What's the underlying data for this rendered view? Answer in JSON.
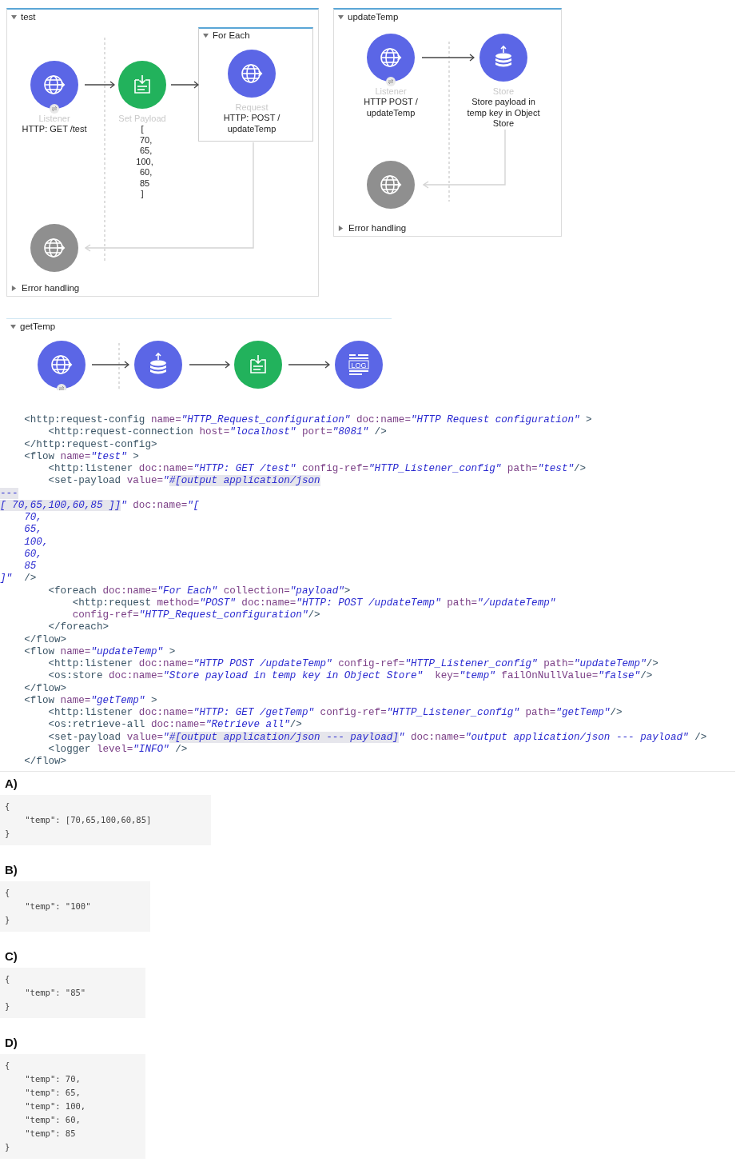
{
  "flows": [
    {
      "title": "test",
      "expanded": true,
      "nodes": [
        {
          "kind": "listener",
          "type_label": "Listener",
          "caption": "HTTP: GET /test"
        },
        {
          "kind": "set-payload",
          "type_label": "Set Payload",
          "caption": "[\n   70,\n   65,\n  100,\n   60,\n  85\n]"
        },
        {
          "kind": "request",
          "type_label": "Request",
          "caption": "HTTP: POST /\nupdateTemp"
        }
      ],
      "scope": {
        "title": "For Each",
        "expanded": true
      },
      "error_handling": {
        "label": "Error handling",
        "expanded": false
      }
    },
    {
      "title": "updateTemp",
      "expanded": true,
      "nodes": [
        {
          "kind": "listener",
          "type_label": "Listener",
          "caption": "HTTP POST /\nupdateTemp"
        },
        {
          "kind": "store",
          "type_label": "Store",
          "caption": "Store payload in\ntemp key in Object\nStore"
        }
      ],
      "error_handling": {
        "label": "Error handling",
        "expanded": false
      }
    },
    {
      "title": "getTemp",
      "expanded": true,
      "nodes": [
        {
          "kind": "listener"
        },
        {
          "kind": "store"
        },
        {
          "kind": "set-payload"
        },
        {
          "kind": "logger",
          "icon_text": "LOG"
        }
      ]
    }
  ],
  "code_lines": [
    [
      {
        "kind": "tag",
        "text": "    <http:request-config "
      },
      {
        "kind": "attr",
        "text": "name="
      },
      {
        "kind": "value",
        "text": "\"HTTP_Request_configuration\""
      },
      {
        "kind": "attr",
        "text": " doc:name="
      },
      {
        "kind": "value",
        "text": "\"HTTP Request configuration\""
      },
      {
        "kind": "tag",
        "text": " >"
      }
    ],
    [
      {
        "kind": "tag",
        "text": "        <http:request-connection "
      },
      {
        "kind": "attr",
        "text": "host="
      },
      {
        "kind": "value",
        "text": "\"localhost\""
      },
      {
        "kind": "attr",
        "text": " port="
      },
      {
        "kind": "value",
        "text": "\"8081\""
      },
      {
        "kind": "tag",
        "text": " />"
      }
    ],
    [
      {
        "kind": "tag",
        "text": "    </http:request-config>"
      }
    ],
    [
      {
        "kind": "tag",
        "text": "    <flow "
      },
      {
        "kind": "attr",
        "text": "name="
      },
      {
        "kind": "value",
        "text": "\"test\""
      },
      {
        "kind": "tag",
        "text": " >"
      }
    ],
    [
      {
        "kind": "tag",
        "text": "        <http:listener "
      },
      {
        "kind": "attr",
        "text": "doc:name="
      },
      {
        "kind": "value",
        "text": "\"HTTP: GET /test\""
      },
      {
        "kind": "attr",
        "text": " config-ref="
      },
      {
        "kind": "value",
        "text": "\"HTTP_Listener_config\""
      },
      {
        "kind": "attr",
        "text": " path="
      },
      {
        "kind": "value",
        "text": "\"test\""
      },
      {
        "kind": "tag",
        "text": "/>"
      }
    ],
    [
      {
        "kind": "tag",
        "text": "        <set-payload "
      },
      {
        "kind": "attr",
        "text": "value="
      },
      {
        "kind": "value",
        "text": "\""
      },
      {
        "kind": "value",
        "text": "#[output application/json",
        "highlighted": true
      }
    ],
    [
      {
        "kind": "value",
        "text": "---",
        "highlighted": true
      }
    ],
    [
      {
        "kind": "value",
        "text": "[ 70,65,100,60,85 ]]",
        "highlighted": true
      },
      {
        "kind": "value",
        "text": "\""
      },
      {
        "kind": "attr",
        "text": " doc:name="
      },
      {
        "kind": "value",
        "text": "\"["
      }
    ],
    [
      {
        "kind": "value",
        "text": "    70,"
      }
    ],
    [
      {
        "kind": "value",
        "text": "    65,"
      }
    ],
    [
      {
        "kind": "value",
        "text": "    100,"
      }
    ],
    [
      {
        "kind": "value",
        "text": "    60,"
      }
    ],
    [
      {
        "kind": "value",
        "text": "    85"
      }
    ],
    [
      {
        "kind": "value",
        "text": "]\""
      },
      {
        "kind": "tag",
        "text": "  />"
      }
    ],
    [
      {
        "kind": "tag",
        "text": "        <foreach "
      },
      {
        "kind": "attr",
        "text": "doc:name="
      },
      {
        "kind": "value",
        "text": "\"For Each\""
      },
      {
        "kind": "attr",
        "text": " collection="
      },
      {
        "kind": "value",
        "text": "\"payload\""
      },
      {
        "kind": "tag",
        "text": ">"
      }
    ],
    [
      {
        "kind": "tag",
        "text": "            <http:request "
      },
      {
        "kind": "attr",
        "text": "method="
      },
      {
        "kind": "value",
        "text": "\"POST\""
      },
      {
        "kind": "attr",
        "text": " doc:name="
      },
      {
        "kind": "value",
        "text": "\"HTTP: POST /updateTemp\""
      },
      {
        "kind": "attr",
        "text": " path="
      },
      {
        "kind": "value",
        "text": "\"/updateTemp\""
      }
    ],
    [
      {
        "kind": "attr",
        "text": "            config-ref="
      },
      {
        "kind": "value",
        "text": "\"HTTP_Request_configuration\""
      },
      {
        "kind": "tag",
        "text": "/>"
      }
    ],
    [
      {
        "kind": "tag",
        "text": "        </foreach>"
      }
    ],
    [
      {
        "kind": "tag",
        "text": "    </flow>"
      }
    ],
    [
      {
        "kind": "tag",
        "text": "    <flow "
      },
      {
        "kind": "attr",
        "text": "name="
      },
      {
        "kind": "value",
        "text": "\"updateTemp\""
      },
      {
        "kind": "tag",
        "text": " >"
      }
    ],
    [
      {
        "kind": "tag",
        "text": "        <http:listener "
      },
      {
        "kind": "attr",
        "text": "doc:name="
      },
      {
        "kind": "value",
        "text": "\"HTTP POST /updateTemp\""
      },
      {
        "kind": "attr",
        "text": " config-ref="
      },
      {
        "kind": "value",
        "text": "\"HTTP_Listener_config\""
      },
      {
        "kind": "attr",
        "text": " path="
      },
      {
        "kind": "value",
        "text": "\"updateTemp\""
      },
      {
        "kind": "tag",
        "text": "/>"
      }
    ],
    [
      {
        "kind": "tag",
        "text": "        <os:store "
      },
      {
        "kind": "attr",
        "text": "doc:name="
      },
      {
        "kind": "value",
        "text": "\"Store payload in temp key in Object Store\""
      },
      {
        "kind": "attr",
        "text": "  key="
      },
      {
        "kind": "value",
        "text": "\"temp\""
      },
      {
        "kind": "attr",
        "text": " failOnNullValue="
      },
      {
        "kind": "value",
        "text": "\"false\""
      },
      {
        "kind": "tag",
        "text": "/>"
      }
    ],
    [
      {
        "kind": "tag",
        "text": "    </flow>"
      }
    ],
    [
      {
        "kind": "tag",
        "text": "    <flow "
      },
      {
        "kind": "attr",
        "text": "name="
      },
      {
        "kind": "value",
        "text": "\"getTemp\""
      },
      {
        "kind": "tag",
        "text": " >"
      }
    ],
    [
      {
        "kind": "tag",
        "text": "        <http:listener "
      },
      {
        "kind": "attr",
        "text": "doc:name="
      },
      {
        "kind": "value",
        "text": "\"HTTP: GET /getTemp\""
      },
      {
        "kind": "attr",
        "text": " config-ref="
      },
      {
        "kind": "value",
        "text": "\"HTTP_Listener_config\""
      },
      {
        "kind": "attr",
        "text": " path="
      },
      {
        "kind": "value",
        "text": "\"getTemp\""
      },
      {
        "kind": "tag",
        "text": "/>"
      }
    ],
    [
      {
        "kind": "tag",
        "text": "        <os:retrieve-all "
      },
      {
        "kind": "attr",
        "text": "doc:name="
      },
      {
        "kind": "value",
        "text": "\"Retrieve all\""
      },
      {
        "kind": "tag",
        "text": "/>"
      }
    ],
    [
      {
        "kind": "tag",
        "text": "        <set-payload "
      },
      {
        "kind": "attr",
        "text": "value="
      },
      {
        "kind": "value",
        "text": "\""
      },
      {
        "kind": "value",
        "text": "#[output application/json --- payload]",
        "highlighted": true
      },
      {
        "kind": "value",
        "text": "\""
      },
      {
        "kind": "attr",
        "text": " doc:name="
      },
      {
        "kind": "value",
        "text": "\"output application/json --- payload\""
      },
      {
        "kind": "tag",
        "text": " />"
      }
    ],
    [
      {
        "kind": "tag",
        "text": "        <logger "
      },
      {
        "kind": "attr",
        "text": "level="
      },
      {
        "kind": "value",
        "text": "\"INFO\""
      },
      {
        "kind": "tag",
        "text": " />"
      }
    ],
    [
      {
        "kind": "tag",
        "text": "    </flow>"
      }
    ]
  ],
  "options": [
    {
      "label": "A)",
      "lines": [
        "{",
        "    \"temp\": [70,65,100,60,85]",
        "}"
      ]
    },
    {
      "label": "B)",
      "lines": [
        "{",
        "    \"temp\": \"100\"",
        "}"
      ]
    },
    {
      "label": "C)",
      "lines": [
        "{",
        "    \"temp\": \"85\"",
        "}"
      ]
    },
    {
      "label": "D)",
      "lines": [
        "{",
        "    \"temp\": 70,",
        "    \"temp\": 65,",
        "    \"temp\": 100,",
        "    \"temp\": 60,",
        "    \"temp\": 85",
        "}"
      ]
    }
  ]
}
